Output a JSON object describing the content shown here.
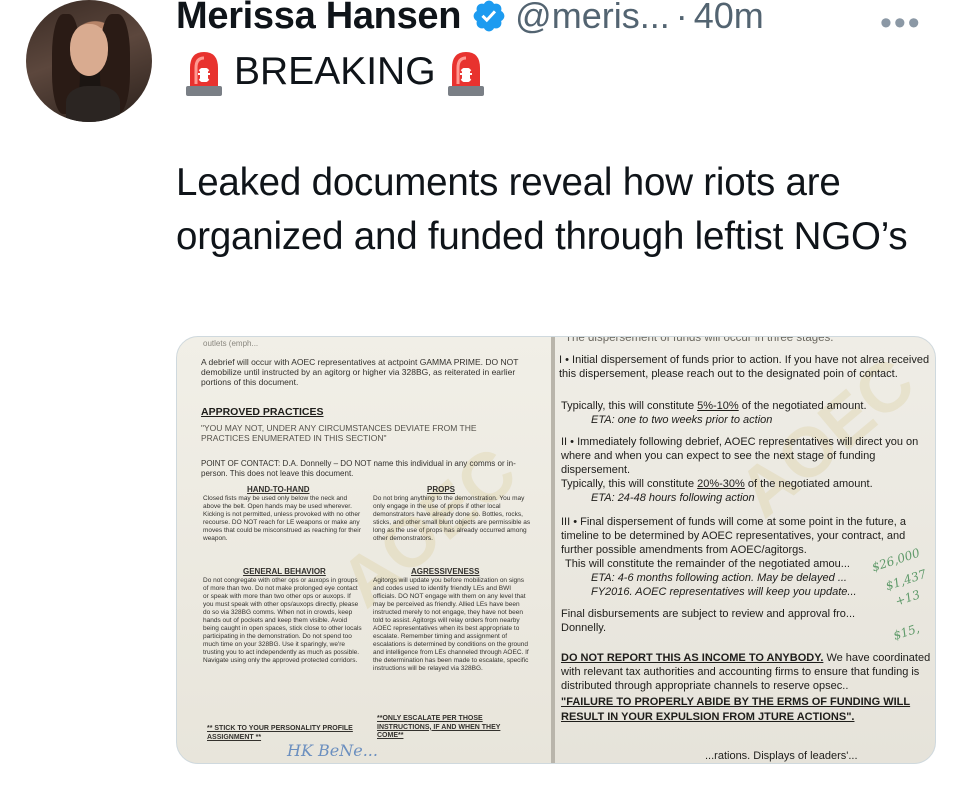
{
  "post": {
    "author_name": "Merissa Hansen",
    "handle": "@meris...",
    "separator": "·",
    "time": "40m",
    "more": "•••",
    "breaking_label": "BREAKING",
    "body": "Leaked documents reveal how riots are organized and funded through leftist NGO’s"
  },
  "icons": {
    "verified": "verified-badge-icon",
    "siren": "siren-emoji-icon",
    "more": "more-options-icon"
  },
  "colors": {
    "verified_blue": "#1d9bf0",
    "muted": "#536471",
    "siren_red": "#e8322e"
  },
  "media": {
    "left_doc": {
      "top_cut": "outlets (emph...",
      "intro": "A debrief will occur with AOEC representatives at actpoint GAMMA PRIME. DO NOT demobilize until instructed by an agitorg or higher via 328BG, as reiterated in earlier portions of this document.",
      "approved_heading": "APPROVED PRACTICES",
      "warning": "\"YOU MAY NOT, UNDER ANY CIRCUMSTANCES DEVIATE FROM THE PRACTICES ENUMERATED IN THIS SECTION\"",
      "poc": "POINT OF CONTACT: D.A. Donnelly – DO NOT name this individual in any comms or in-person. This does not leave this document.",
      "hand_heading": "HAND-TO-HAND",
      "hand_items": "Closed fists may be used only below the neck and above the belt. Open hands may be used wherever. Kicking is not permitted, unless provoked with no other recourse. DO NOT reach for LE weapons or make any moves that could be misconstrued as reaching for their weapon.",
      "props_heading": "PROPS",
      "props_items": "Do not bring anything to the demonstration. You may only engage in the use of props if other local demonstrators have already done so. Bottles, rocks, sticks, and other small blunt objects are permissible as long as the use of props has already occurred among other demonstrators.",
      "general_heading": "GENERAL BEHAVIOR",
      "general_items": "Do not congregate with other ops or auxops in groups of more than two. Do not make prolonged eye contact or speak with more than two other ops or auxops. If you must speak with other ops/auxops directly, please do so via 328BG comms. When not in crowds, keep hands out of pockets and keep them visible. Avoid being caught in open spaces, stick close to other locals participating in the demonstration. Do not spend too much time on your 328BG. Use it sparingly, we're trusting you to act independently as much as possible. Navigate using only the approved protected corridors.",
      "stick_line": "** STICK TO YOUR PERSONALITY PROFILE ASSIGNMENT **",
      "aggr_heading": "AGRESSIVENESS",
      "aggr_items": "Agitorgs will update you before mobilization on signs and codes used to identify friendly LEs and BWI officials. DO NOT engage with them on any level that may be perceived as friendly. Allied LEs have been instructed merely to not engage, they have not been told to assist. Agitorgs will relay orders from nearby AOEC representatives when its best appropriate to escalate. Remember timing and assignment of escalations is determined by conditions on the ground and intelligence from LEs channeled through AOEC. If the determination has been made to escalate, specific instructions will be relayed via 328BG.",
      "aggr_end": "**ONLY ESCALATE PER THOSE INSTRUCTIONS, IF AND WHEN THEY COME**",
      "signature": "HK BeNe..."
    },
    "right_doc": {
      "top_cut": "The dispersement of funds will occur in three stages:",
      "s1": "I • Initial dispersement of funds prior to action. If you have not alrea received this dispersement, please reach out to the designated poin of contact.",
      "s1_typ_pre": "Typically, this will constitute ",
      "s1_pct": "5%-10%",
      "s1_typ_post": " of the negotiated amount.",
      "s1_eta": "ETA: one to two weeks prior to action",
      "s2": "II • Immediately following debrief, AOEC representatives will direct you on where and when you can expect to see the next stage of funding dispersement.",
      "s2_typ_pre": "Typically, this will constitute ",
      "s2_pct": "20%-30%",
      "s2_typ_post": " of the negotiated amount.",
      "s2_eta": "ETA: 24-48 hours following action",
      "s3": "III • Final dispersement of funds will come at some point in the future, a timeline to be determined by AOEC representatives, your contract, and further possible amendments from AOEC/agitorgs.",
      "s3_rem": "This will constitute the remainder of the negotiated amou...",
      "s3_eta": "ETA: 4-6 months following action. May be delayed ...",
      "s3_fy": "FY2016. AOEC representatives will keep you update...",
      "final": "Final disbursements are subject to review and approval fro... Donnelly.",
      "noreport_bold": "DO NOT REPORT THIS AS INCOME TO ANYBODY.",
      "noreport_rest": " We have coordinated with relevant tax authorities and accounting firms to ensure that funding is distributed through appropriate channels to reserve opsec..",
      "fail": "\"FAILURE TO PROPERLY ABIDE BY THE ERMS OF FUNDING WILL RESULT IN YOUR EXPULSION FROM JTURE ACTIONS\".",
      "bottom_cut": "...rations. Displays of leaders'...",
      "hw1": "$26,000",
      "hw2": "$1,437",
      "hw3": "+13",
      "hw4": "$15,"
    }
  }
}
